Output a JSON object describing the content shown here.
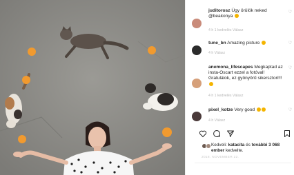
{
  "comments": [
    {
      "username": "juditorosz",
      "text": "Úgy örülök neked @beakonya",
      "meta": "4 h   1 kedvelés   Válasz",
      "avatar_color": "#c98b7a"
    },
    {
      "username": "tune_bn",
      "text": "Amazing picture",
      "meta": "4 h   Válasz",
      "avatar_color": "#2b2b2b"
    },
    {
      "username": "anemona_lifescapes",
      "text": "Megkaptad az insta-Oscart ezzel a fotóval! Gratulálok, ez gyönyörű sikersztori!!!",
      "meta": "4 h   1 kedvelés   Válasz",
      "avatar_color": "#d6a07a"
    },
    {
      "username": "pixel_kotze",
      "text": "Very good",
      "meta": "4 h   Válasz",
      "avatar_color": "#4a3a3a"
    }
  ],
  "actions": {
    "like_icon": "heart-icon",
    "comment_icon": "comment-icon",
    "share_icon": "share-icon",
    "save_icon": "bookmark-icon"
  },
  "likes": {
    "prefix": "Kedveli: ",
    "user": "katacita",
    "middle": " és ",
    "rest": "további 3 068 ember",
    "suffix": "kedvelte."
  },
  "date_label": "2018. NOVEMBER 22.",
  "photo": {
    "alt": "Woman lying on pavement surrounded by cats and oranges"
  }
}
